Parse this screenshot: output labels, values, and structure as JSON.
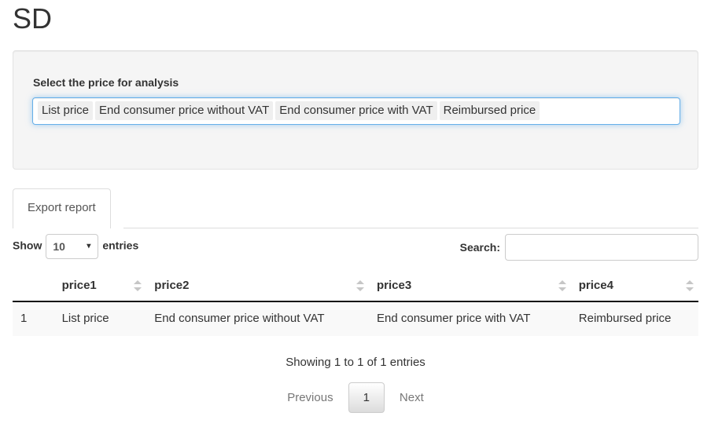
{
  "page": {
    "title": "SD"
  },
  "selector_panel": {
    "label": "Select the price for analysis",
    "selected_tags": [
      "List price",
      "End consumer price without VAT",
      "End consumer price with VAT",
      "Reimbursed price"
    ]
  },
  "tabs": [
    {
      "label": "Export report",
      "active": true
    }
  ],
  "datatable": {
    "length_prefix": "Show",
    "length_value": "10",
    "length_suffix": "entries",
    "length_caret": "▾",
    "search_label": "Search:",
    "search_value": "",
    "search_placeholder": "",
    "columns": [
      {
        "label": "",
        "sortable": false
      },
      {
        "label": "price1",
        "sortable": true
      },
      {
        "label": "price2",
        "sortable": true
      },
      {
        "label": "price3",
        "sortable": true
      },
      {
        "label": "price4",
        "sortable": true
      }
    ],
    "rows": [
      {
        "index": "1",
        "price1": "List price",
        "price2": "End consumer price without VAT",
        "price3": "End consumer price with VAT",
        "price4": "Reimbursed price"
      }
    ],
    "info": "Showing 1 to 1 of 1 entries",
    "pagination": {
      "previous": "Previous",
      "current_page": "1",
      "next": "Next"
    }
  },
  "colors": {
    "focus_border": "#66afe9",
    "well_bg": "#f5f5f5",
    "tag_bg": "#efefef",
    "row_bg": "#f9f9f9",
    "header_rule": "#111111"
  }
}
